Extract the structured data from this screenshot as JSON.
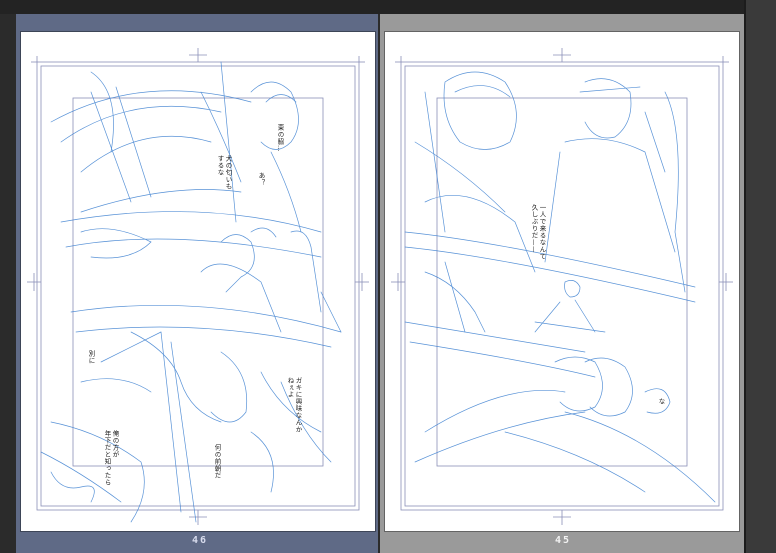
{
  "spread": {
    "left_page": {
      "number": "46",
      "dialogue": [
        "東の脇…",
        "あ？",
        "犬の匂いも\nするな",
        "別に",
        "ガキに興味なんか\nねぇよ",
        "俺の方が\n年下だと知ったら",
        "何の前朝だ"
      ]
    },
    "right_page": {
      "number": "45",
      "dialogue": [
        "一人で来るなんて\n久しぶりだ——",
        "な"
      ]
    }
  },
  "colors": {
    "workspace": "#2b2b2b",
    "active_page_frame": "#5f6a86",
    "inactive_page_frame": "#9a9a9a",
    "sketch_line": "#3b7fd0",
    "guide_line": "#8a8fb8"
  }
}
